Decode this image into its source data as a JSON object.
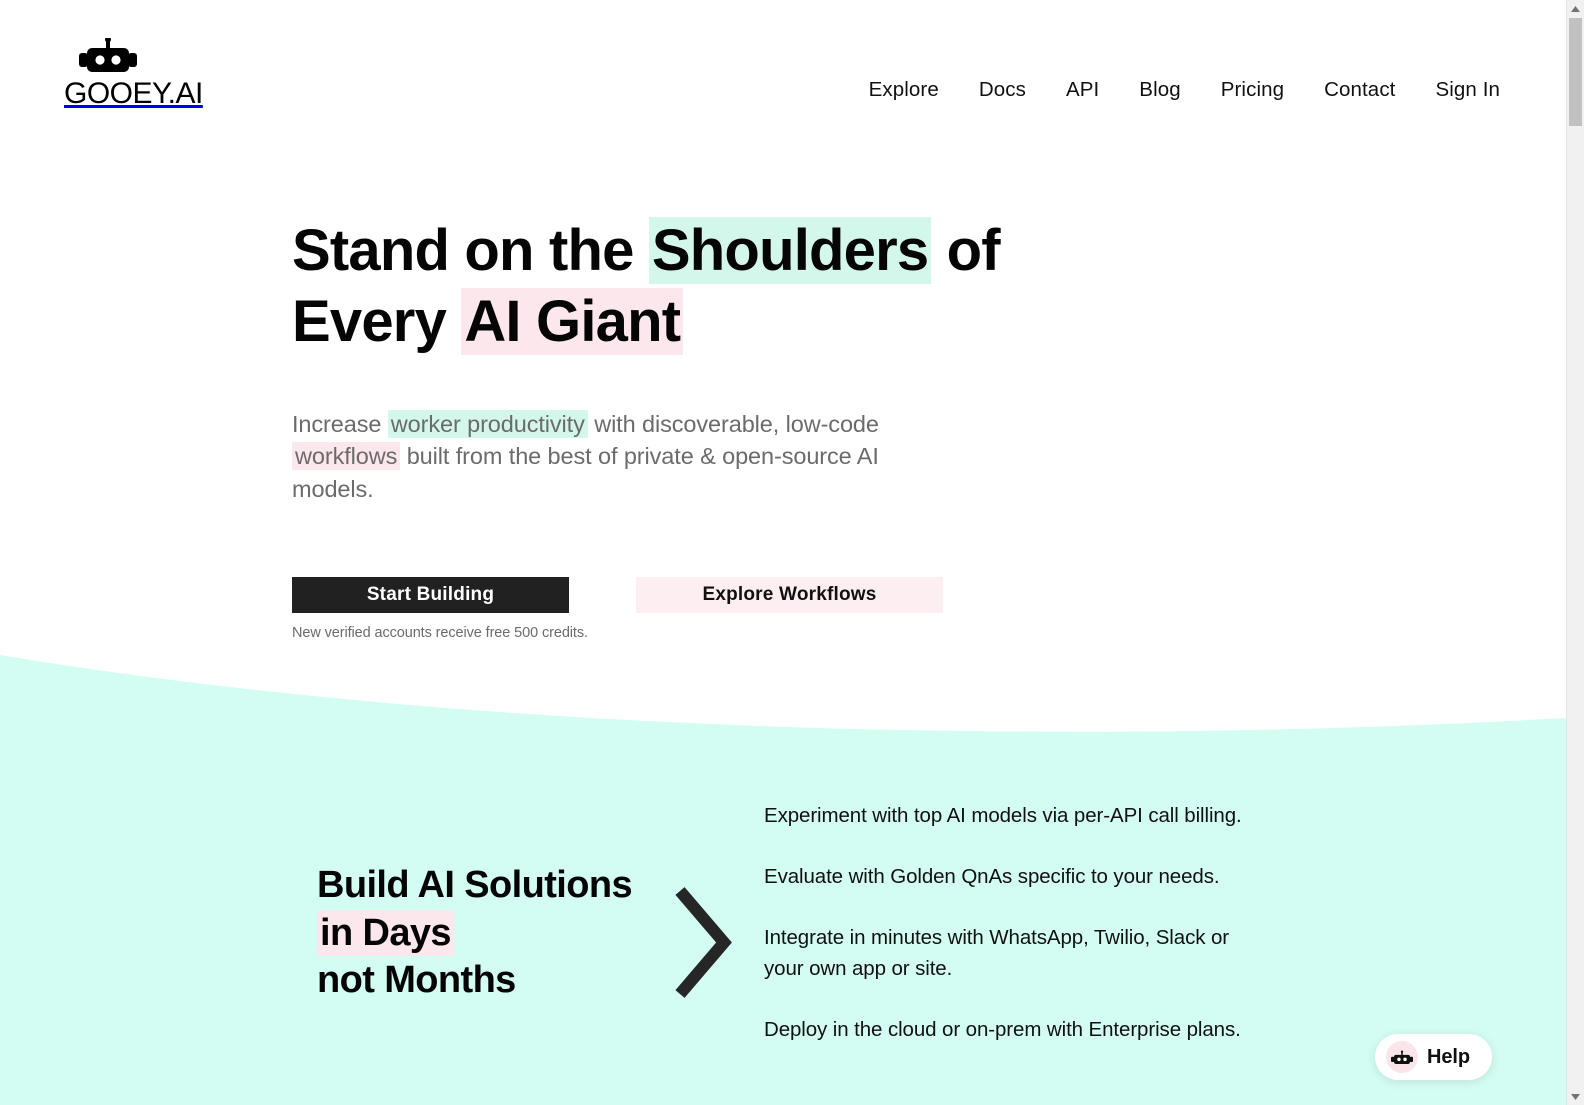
{
  "header": {
    "logo": {
      "icon": "robot-head-icon",
      "text": "GOOEY.AI"
    },
    "nav": [
      {
        "label": "Explore"
      },
      {
        "label": "Docs"
      },
      {
        "label": "API"
      },
      {
        "label": "Blog"
      },
      {
        "label": "Pricing"
      },
      {
        "label": "Contact"
      },
      {
        "label": "Sign In"
      }
    ]
  },
  "hero": {
    "title": {
      "line1_prefix": "Stand on the ",
      "line1_highlight": "Shoulders",
      "line1_suffix": " of",
      "line2_prefix": "Every ",
      "line2_highlight": "AI Giant"
    },
    "subtitle": {
      "part1": "Increase ",
      "highlight1": "worker productivity",
      "part2": " with discoverable, low-code ",
      "highlight2": "workflows",
      "part3": " built from the best of private & open-source AI models."
    },
    "primary_cta": "Start Building",
    "secondary_cta": "Explore Workflows",
    "cta_note": "New verified accounts receive free 500 credits."
  },
  "features": {
    "heading": {
      "line1": "Build AI Solutions",
      "line2_highlight": "in Days",
      "line3": "not Months"
    },
    "arrow_icon": "chevron-right-icon",
    "bullets": [
      "Experiment with top AI models via per-API call billing.",
      "Evaluate with Golden QnAs specific to your needs.",
      "Integrate in minutes with WhatsApp, Twilio, Slack or your own app or site.",
      "Deploy in the cloud or on-prem with Enterprise plans."
    ]
  },
  "help_widget": {
    "icon": "robot-head-icon",
    "label": "Help"
  },
  "colors": {
    "mint_section": "#d3fcf2",
    "mint_highlight": "#d4f7ec",
    "pink_highlight": "#fce7ed",
    "pink_button": "#fdeef1",
    "dark_button": "#212121",
    "text": "#111111",
    "muted_text": "#6b6b6b"
  }
}
